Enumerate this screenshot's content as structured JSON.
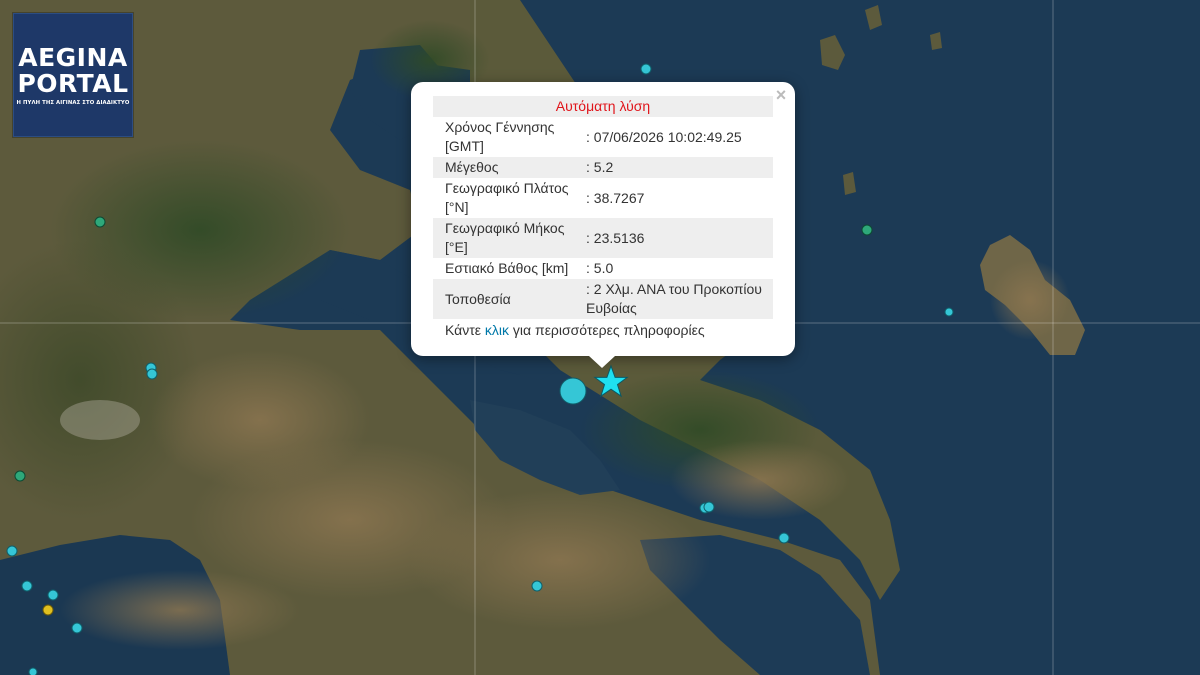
{
  "logo": {
    "line1": "AEGINA",
    "line2": "PORTAL",
    "tagline": "Η ΠΥΛΗ ΤΗΣ ΑΙΓΙΝΑΣ ΣΤΟ ΔΙΑΔΙΚΤΥΟ"
  },
  "popup": {
    "close": "×",
    "title": "Αυτόματη λύση",
    "rows": [
      {
        "key": "Χρόνος Γέννησης [GMT]",
        "value": ": 07/06/2026 10:02:49.25"
      },
      {
        "key": "Μέγεθος",
        "value": ": 5.2"
      },
      {
        "key": "Γεωγραφικό Πλάτος [°N]",
        "value": ": 38.7267"
      },
      {
        "key": "Γεωγραφικό Μήκος [°E]",
        "value": ": 23.5136"
      },
      {
        "key": "Εστιακό Βάθος [km]",
        "value": ": 5.0"
      },
      {
        "key": "Τοποθεσία",
        "value": ": 2 Χλμ. ΑΝΑ του Προκοπίου Ευβοίας"
      }
    ],
    "more_prefix": "Κάντε ",
    "more_link": "κλικ",
    "more_suffix": " για περισσότερες πληροφορίες"
  },
  "colors": {
    "title_red": "#e0151b",
    "link_blue": "#0078a8",
    "star": "#1fe0f0",
    "quake_cyan": "#35c6d6",
    "quake_green": "#2ea87a",
    "quake_yellow": "#e0c020",
    "logo_bg": "#1e3868"
  },
  "icons": {
    "epicenter": "star-icon",
    "close": "close-icon"
  }
}
